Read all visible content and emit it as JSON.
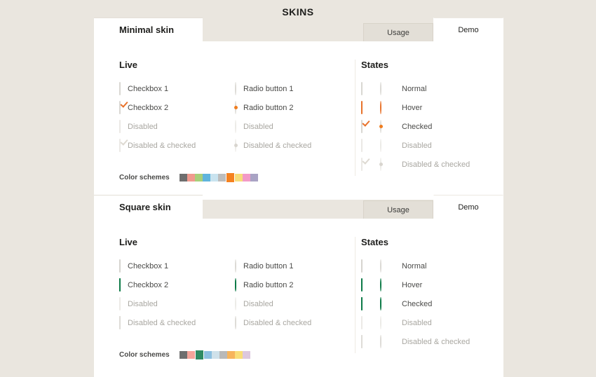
{
  "page": {
    "title": "SKINS",
    "background": "#eae6df"
  },
  "panels": [
    {
      "id": "minimal",
      "tab_title": "Minimal skin",
      "tabs": [
        {
          "label": "Usage",
          "active": false
        },
        {
          "label": "Demo",
          "active": true
        }
      ],
      "live": {
        "heading": "Live",
        "checkboxes": [
          {
            "label": "Checkbox 1",
            "state": "normal"
          },
          {
            "label": "Checkbox 2",
            "state": "checked"
          },
          {
            "label": "Disabled",
            "state": "disabled"
          },
          {
            "label": "Disabled & checked",
            "state": "disabled-checked"
          }
        ],
        "radios": [
          {
            "label": "Radio button 1",
            "state": "normal"
          },
          {
            "label": "Radio button 2",
            "state": "checked"
          },
          {
            "label": "Disabled",
            "state": "disabled"
          },
          {
            "label": "Disabled & checked",
            "state": "disabled-checked"
          }
        ]
      },
      "states": {
        "heading": "States",
        "rows": [
          {
            "label": "Normal",
            "state": "normal"
          },
          {
            "label": "Hover",
            "state": "hover"
          },
          {
            "label": "Checked",
            "state": "checked"
          },
          {
            "label": "Disabled",
            "state": "disabled"
          },
          {
            "label": "Disabled & checked",
            "state": "disabled-checked"
          }
        ]
      },
      "color_schemes": {
        "label": "Color schemes",
        "selected_index": 6,
        "colors": [
          "#6e6e6e",
          "#f09a8e",
          "#a8cf7a",
          "#5fb4dd",
          "#c9e3ef",
          "#bdbdbd",
          "#f58220",
          "#f6dd7a",
          "#f29ac7",
          "#a9a3c4"
        ]
      },
      "accent": "#e8722a"
    },
    {
      "id": "square",
      "tab_title": "Square skin",
      "tabs": [
        {
          "label": "Usage",
          "active": false
        },
        {
          "label": "Demo",
          "active": true
        }
      ],
      "live": {
        "heading": "Live",
        "checkboxes": [
          {
            "label": "Checkbox 1",
            "state": "normal"
          },
          {
            "label": "Checkbox 2",
            "state": "checked"
          },
          {
            "label": "Disabled",
            "state": "disabled"
          },
          {
            "label": "Disabled & checked",
            "state": "disabled-checked"
          }
        ],
        "radios": [
          {
            "label": "Radio button 1",
            "state": "normal"
          },
          {
            "label": "Radio button 2",
            "state": "checked"
          },
          {
            "label": "Disabled",
            "state": "disabled"
          },
          {
            "label": "Disabled & checked",
            "state": "disabled-checked"
          }
        ]
      },
      "states": {
        "heading": "States",
        "rows": [
          {
            "label": "Normal",
            "state": "normal"
          },
          {
            "label": "Hover",
            "state": "hover"
          },
          {
            "label": "Checked",
            "state": "checked"
          },
          {
            "label": "Disabled",
            "state": "disabled"
          },
          {
            "label": "Disabled & checked",
            "state": "disabled-checked"
          }
        ]
      },
      "color_schemes": {
        "label": "Color schemes",
        "selected_index": 2,
        "colors": [
          "#6e6e6e",
          "#f4a49a",
          "#2e8b63",
          "#8cc0e0",
          "#cfe1ea",
          "#b9b9b9",
          "#f7b45c",
          "#f9dd78",
          "#ddc8de",
          "#ада8c9"
        ]
      },
      "accent": "#0d7a47"
    }
  ]
}
